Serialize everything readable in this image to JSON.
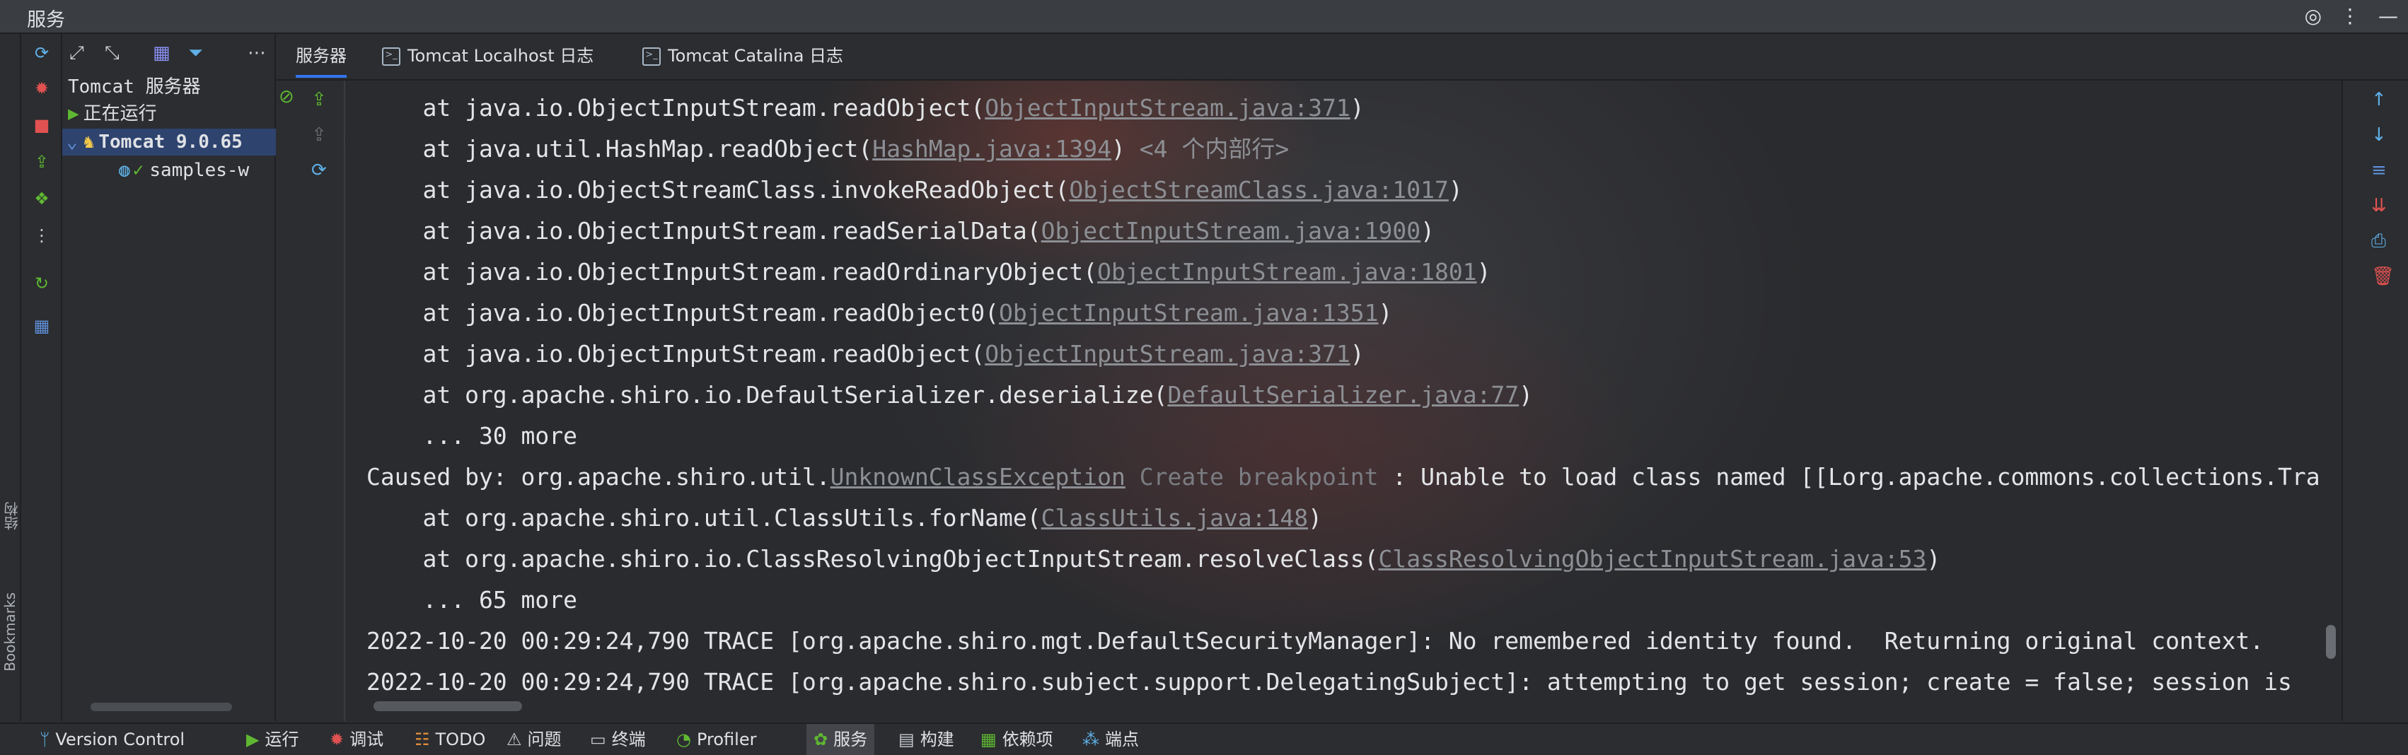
{
  "window": {
    "title": "服务"
  },
  "titlebar_icons": [
    "target-icon",
    "more-vertical-icon",
    "minimize-icon"
  ],
  "side_stripe": {
    "structure": "结构",
    "bookmarks": "Bookmarks"
  },
  "tree": {
    "root": "Tomcat 服务器",
    "running": "正在运行",
    "server": "Tomcat 9.0.65",
    "artifact": "samples-w"
  },
  "tabs": [
    {
      "label": "服务器"
    },
    {
      "label": "Tomcat Localhost 日志"
    },
    {
      "label": "Tomcat Catalina 日志"
    }
  ],
  "console": {
    "lines": [
      {
        "pre": "    at java.io.ObjectInputStream.readObject(",
        "link": "ObjectInputStream.java:371",
        "post": ")"
      },
      {
        "pre": "    at java.util.HashMap.readObject(",
        "link": "HashMap.java:1394",
        "post": ") ",
        "muted": "<4 个内部行>"
      },
      {
        "pre": "    at java.io.ObjectStreamClass.invokeReadObject(",
        "link": "ObjectStreamClass.java:1017",
        "post": ")"
      },
      {
        "pre": "    at java.io.ObjectInputStream.readSerialData(",
        "link": "ObjectInputStream.java:1900",
        "post": ")"
      },
      {
        "pre": "    at java.io.ObjectInputStream.readOrdinaryObject(",
        "link": "ObjectInputStream.java:1801",
        "post": ")"
      },
      {
        "pre": "    at java.io.ObjectInputStream.readObject0(",
        "link": "ObjectInputStream.java:1351",
        "post": ")"
      },
      {
        "pre": "    at java.io.ObjectInputStream.readObject(",
        "link": "ObjectInputStream.java:371",
        "post": ")"
      },
      {
        "pre": "    at org.apache.shiro.io.DefaultSerializer.deserialize(",
        "link": "DefaultSerializer.java:77",
        "post": ")"
      },
      {
        "pre": "    ... 30 more",
        "link": "",
        "post": ""
      },
      {
        "pre": "Caused by: org.apache.shiro.util.",
        "link": "UnknownClassException",
        "hint": " Create breakpoint ",
        "post": ": Unable to load class named [[Lorg.apache.commons.collections.Tra"
      },
      {
        "pre": "    at org.apache.shiro.util.ClassUtils.forName(",
        "link": "ClassUtils.java:148",
        "post": ")"
      },
      {
        "pre": "    at org.apache.shiro.io.ClassResolvingObjectInputStream.resolveClass(",
        "link": "ClassResolvingObjectInputStream.java:53",
        "post": ")"
      },
      {
        "pre": "    ... 65 more",
        "link": "",
        "post": ""
      },
      {
        "pre": "2022-10-20 00:29:24,790 TRACE [org.apache.shiro.mgt.DefaultSecurityManager]: No remembered identity found.  Returning original context.",
        "link": "",
        "post": ""
      },
      {
        "pre": "2022-10-20 00:29:24,790 TRACE [org.apache.shiro.subject.support.DelegatingSubject]: attempting to get session; create = false; session is",
        "link": "",
        "post": ""
      }
    ]
  },
  "bottombar": {
    "items": [
      {
        "label": "Version Control",
        "icon": "branch-icon"
      },
      {
        "label": "运行",
        "icon": "run-icon"
      },
      {
        "label": "调试",
        "icon": "debug-icon"
      },
      {
        "label": "TODO",
        "icon": "todo-icon"
      },
      {
        "label": "问题",
        "icon": "problems-icon"
      },
      {
        "label": "终端",
        "icon": "terminal-icon"
      },
      {
        "label": "Profiler",
        "icon": "profiler-icon"
      },
      {
        "label": "服务",
        "icon": "services-icon"
      },
      {
        "label": "构建",
        "icon": "build-icon"
      },
      {
        "label": "依赖项",
        "icon": "dependencies-icon"
      },
      {
        "label": "端点",
        "icon": "endpoints-icon"
      }
    ]
  },
  "colors": {
    "accent": "#3574f0",
    "selection": "#2e436e",
    "link": "#8c8f94",
    "green": "#5fb832",
    "red": "#e05252"
  }
}
